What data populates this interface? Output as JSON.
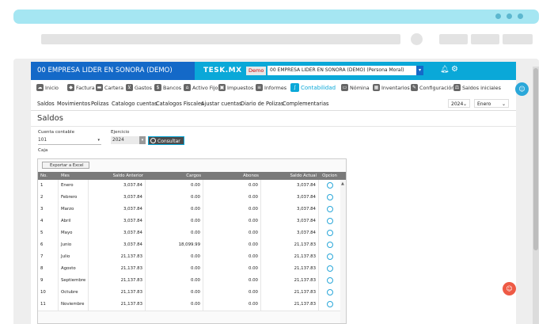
{
  "app": {
    "company_name": "00 EMPRESA LIDER EN SONORA (DEMO)",
    "brand": "TESK.MX",
    "demo_badge": "Demo",
    "company_select": "00 EMPRESA LIDER EN SONORA (DEMO) (Persona Moral)"
  },
  "menu": [
    {
      "label": "Inicio",
      "icon": "cloud-icon"
    },
    {
      "label": "Factura",
      "icon": "tag-icon"
    },
    {
      "label": "Cartera",
      "icon": "briefcase-icon"
    },
    {
      "label": "Gastos",
      "icon": "cart-icon"
    },
    {
      "label": "Bancos",
      "icon": "bank-icon"
    },
    {
      "label": "Activo Fijo",
      "icon": "house-icon"
    },
    {
      "label": "Impuestos",
      "icon": "truck-icon"
    },
    {
      "label": "Informes",
      "icon": "document-icon"
    },
    {
      "label": "Contabilidad",
      "icon": "ledger-icon"
    },
    {
      "label": "Nómina",
      "icon": "card-icon"
    },
    {
      "label": "Inventarios",
      "icon": "boxes-icon"
    },
    {
      "label": "Configuración",
      "icon": "wrench-icon"
    },
    {
      "label": "Saldos iniciales",
      "icon": "balance-icon"
    }
  ],
  "subnav": {
    "items": [
      "Saldos",
      "Movimientos",
      "Polizas",
      "Catalogo cuentas",
      "Catalogos Fiscales",
      "Ajustar cuentas",
      "Diario de Polizas",
      "Complementarias"
    ],
    "year": "2024",
    "month": "Enero"
  },
  "page": {
    "title": "Saldos",
    "cuenta_label": "Cuenta contable",
    "cuenta_value": "101",
    "ejercicio_label": "Ejercicio",
    "ejercicio_value": "2024",
    "consultar": "Consultar",
    "account_name": "Caja",
    "export_label": "Exportar a Excel"
  },
  "table": {
    "headers": [
      "No.",
      "Mes",
      "Saldo Anterior",
      "Cargos",
      "Abonos",
      "Saldo Actual",
      "Opcion"
    ],
    "rows": [
      [
        "1",
        "Enero",
        "3,037.84",
        "0.00",
        "0.00",
        "3,037.84"
      ],
      [
        "2",
        "Febrero",
        "3,037.84",
        "0.00",
        "0.00",
        "3,037.84"
      ],
      [
        "3",
        "Marzo",
        "3,037.84",
        "0.00",
        "0.00",
        "3,037.84"
      ],
      [
        "4",
        "Abril",
        "3,037.84",
        "0.00",
        "0.00",
        "3,037.84"
      ],
      [
        "5",
        "Mayo",
        "3,037.84",
        "0.00",
        "0.00",
        "3,037.84"
      ],
      [
        "6",
        "Junio",
        "3,037.84",
        "18,099.99",
        "0.00",
        "21,137.83"
      ],
      [
        "7",
        "Julio",
        "21,137.83",
        "0.00",
        "0.00",
        "21,137.83"
      ],
      [
        "8",
        "Agosto",
        "21,137.83",
        "0.00",
        "0.00",
        "21,137.83"
      ],
      [
        "9",
        "Septiembre",
        "21,137.83",
        "0.00",
        "0.00",
        "21,137.83"
      ],
      [
        "10",
        "Octubre",
        "21,137.83",
        "0.00",
        "0.00",
        "21,137.83"
      ],
      [
        "11",
        "Noviembre",
        "21,137.83",
        "0.00",
        "0.00",
        "21,137.83"
      ]
    ]
  },
  "colors": {
    "topbar": "#0aa8d8",
    "company_bar": "#1469c8",
    "accent": "#0aa8d8",
    "chat_button_top": "#2aa7d9",
    "chat_button_bottom": "#ee5a45"
  }
}
